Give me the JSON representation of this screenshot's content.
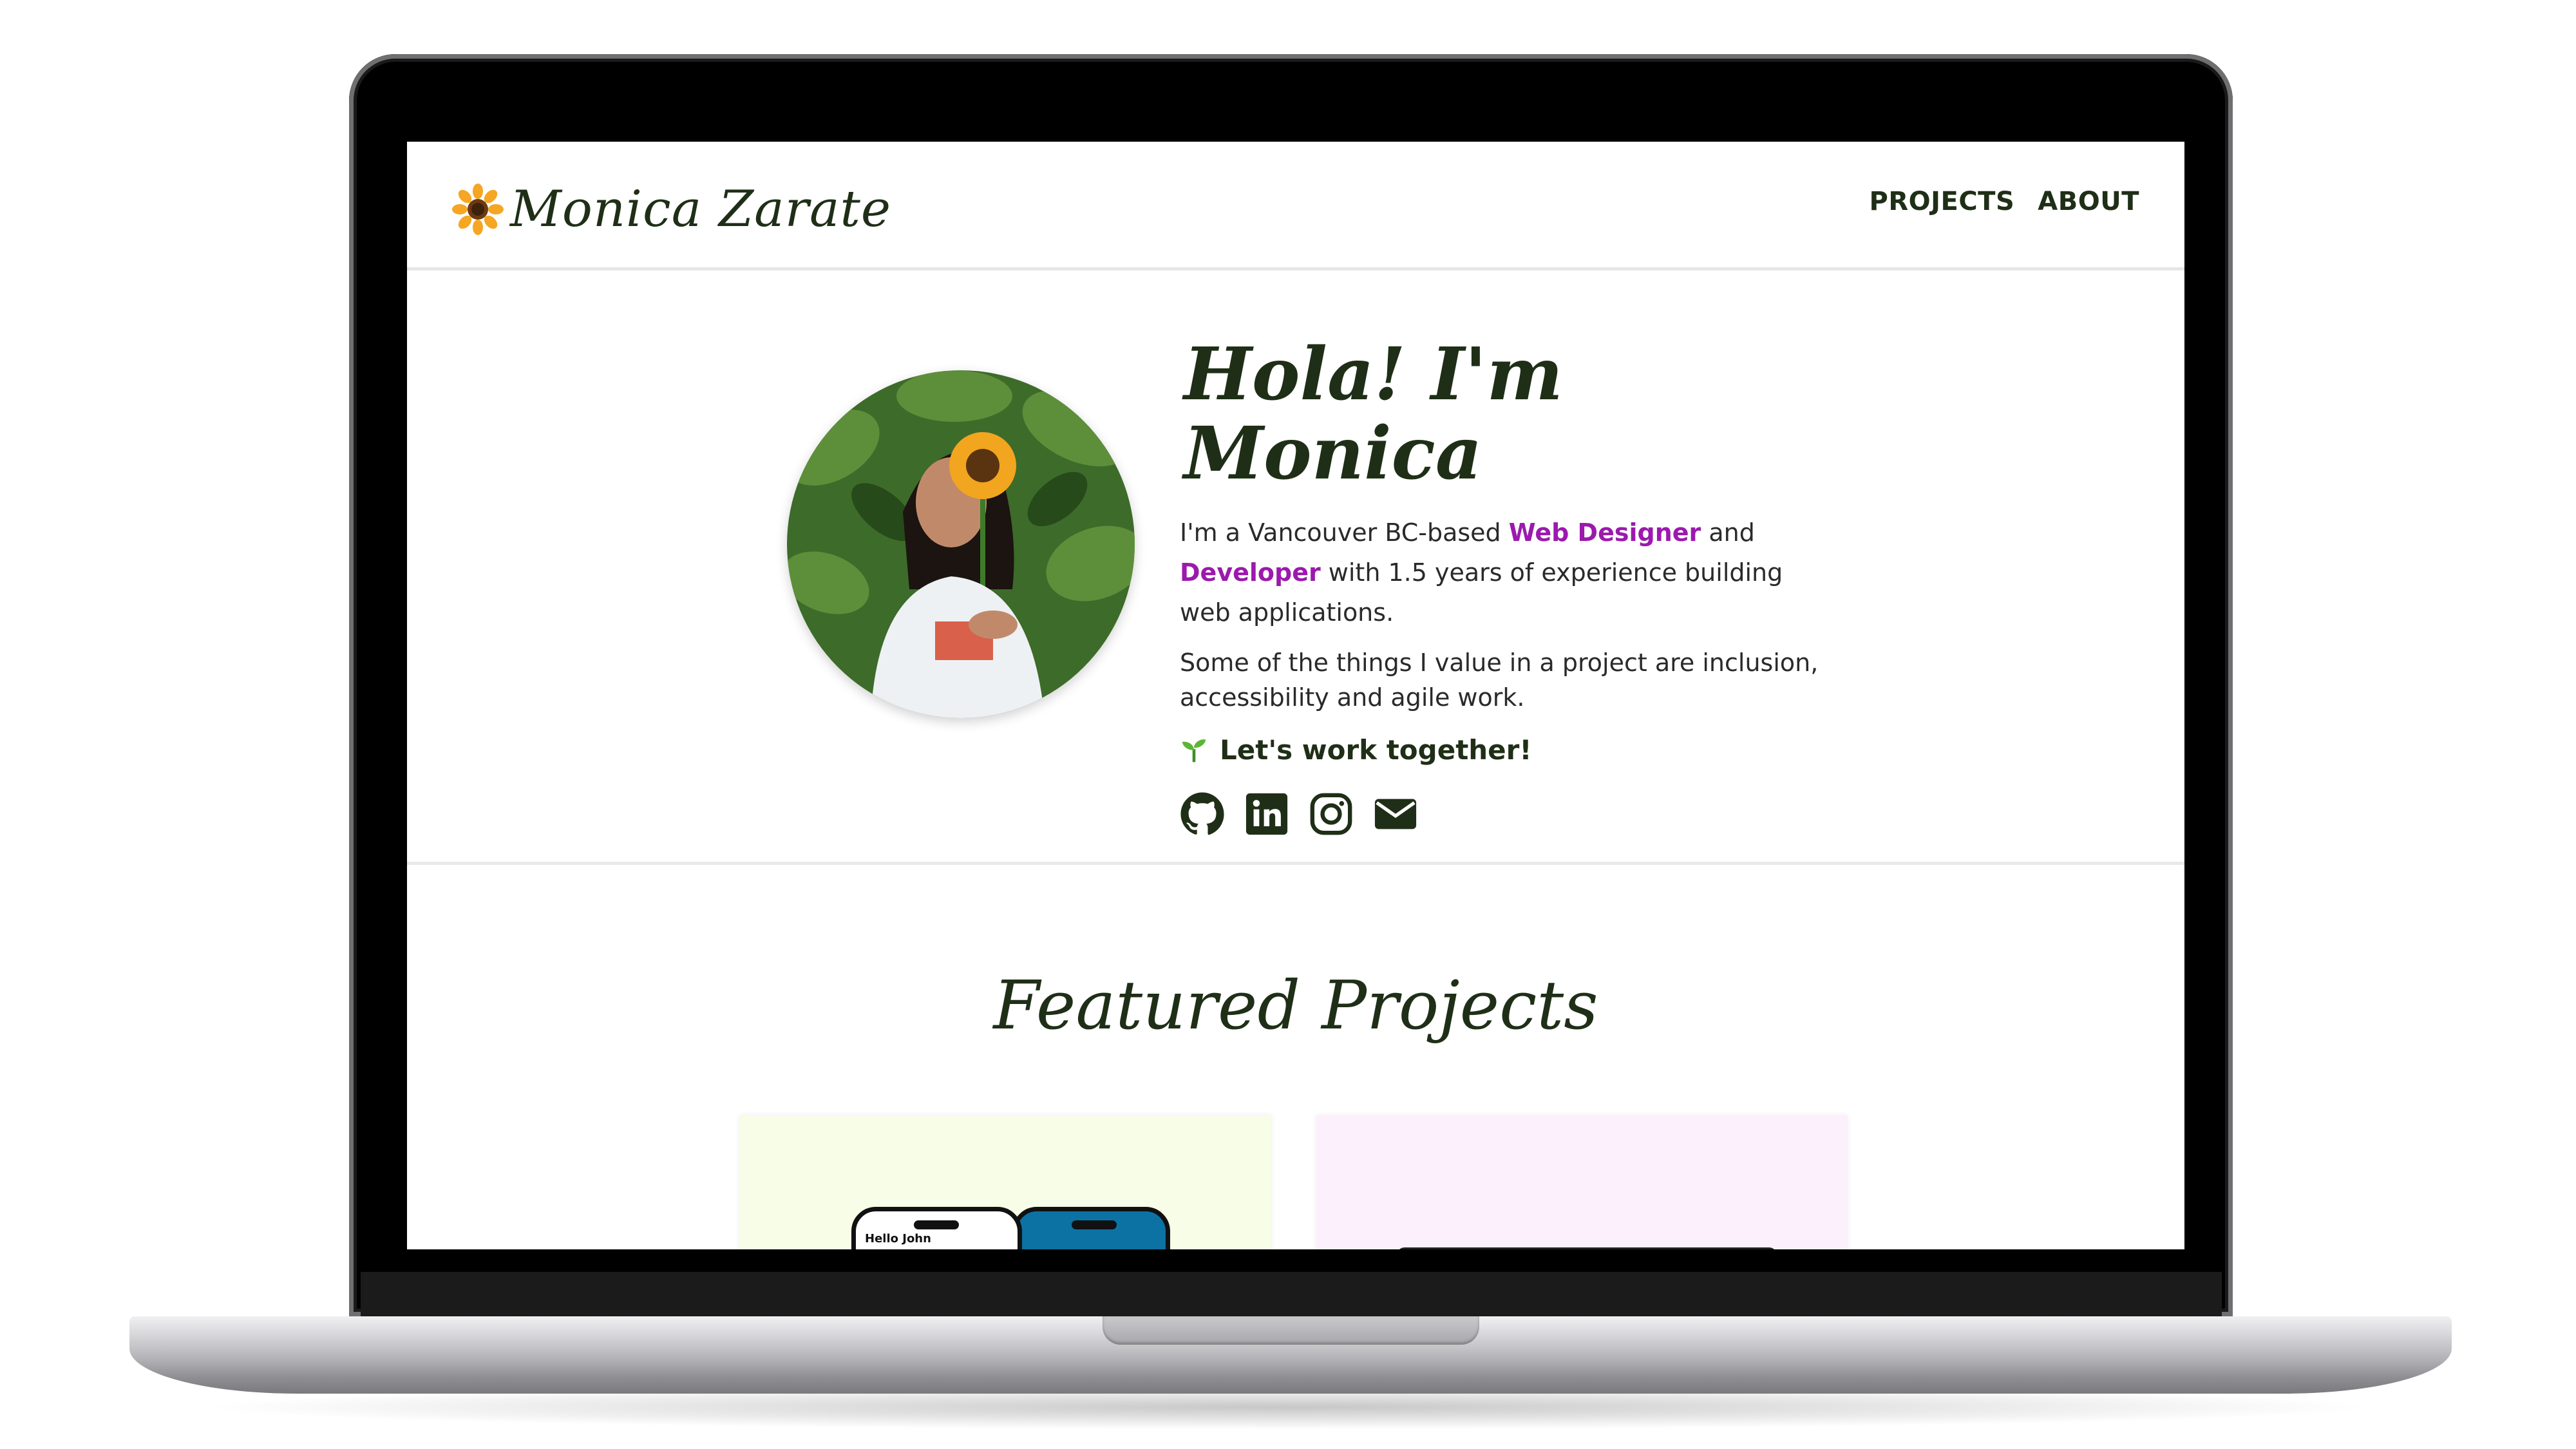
{
  "site": {
    "logo_text": "Monica Zarate",
    "nav": [
      {
        "label": "PROJECTS"
      },
      {
        "label": "ABOUT"
      }
    ]
  },
  "hero": {
    "heading": "Hola! I'm Monica",
    "intro_before": "I'm a Vancouver BC-based ",
    "intro_accent1": "Web Designer",
    "intro_mid": " and ",
    "intro_accent2": "Developer",
    "intro_after": " with 1.5 years of experience building web applications.",
    "values": "Some of the things I value in a project are inclusion, accessibility and agile work.",
    "cta": "Let's work together!",
    "socials": [
      "github-icon",
      "linkedin-icon",
      "instagram-icon",
      "email-icon"
    ]
  },
  "featured": {
    "title": "Featured Projects",
    "card1_phone_text": "Hello John"
  },
  "colors": {
    "accent": "#9b1aad",
    "text_dark": "#1f2f17",
    "card1_bg": "#f8fde8",
    "card2_bg": "#fdf0fd"
  }
}
